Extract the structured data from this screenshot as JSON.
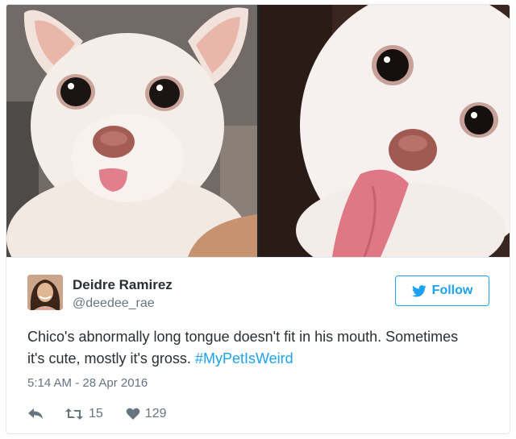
{
  "tweet": {
    "author_name": "Deidre Ramirez",
    "author_handle": "@deedee_rae",
    "follow_label": "Follow",
    "text": "Chico's abnormally long tongue doesn't fit in his mouth. Sometimes it's cute, mostly it's gross.",
    "hashtag": "#MyPetIsWeird",
    "timestamp": "5:14 AM - 28 Apr 2016",
    "retweet_count": "15",
    "like_count": "129"
  },
  "icons": {
    "follow": "twitter-bird-icon",
    "reply": "reply-icon",
    "retweet": "retweet-icon",
    "like": "heart-icon"
  },
  "colors": {
    "accent": "#1da1f2",
    "text": "#292f33",
    "muted": "#66757f",
    "border": "#e1e8ed"
  }
}
